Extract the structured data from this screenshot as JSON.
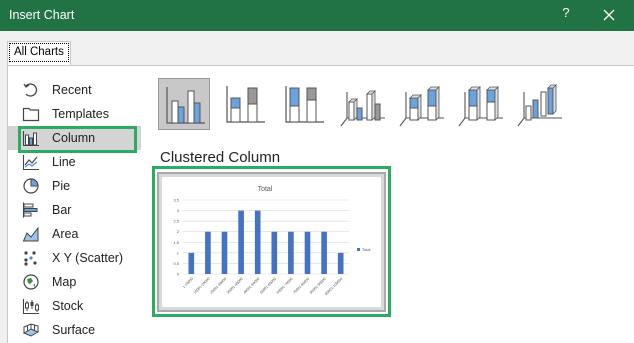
{
  "window": {
    "title": "Insert Chart",
    "help_label": "?"
  },
  "tabs": [
    {
      "label": "All Charts"
    }
  ],
  "sidebar": {
    "items": [
      {
        "label": "Recent",
        "icon": "recent-icon"
      },
      {
        "label": "Templates",
        "icon": "templates-icon"
      },
      {
        "label": "Column",
        "icon": "column-chart-icon",
        "selected": true
      },
      {
        "label": "Line",
        "icon": "line-chart-icon"
      },
      {
        "label": "Pie",
        "icon": "pie-chart-icon"
      },
      {
        "label": "Bar",
        "icon": "bar-chart-icon"
      },
      {
        "label": "Area",
        "icon": "area-chart-icon"
      },
      {
        "label": "X Y (Scatter)",
        "icon": "scatter-chart-icon"
      },
      {
        "label": "Map",
        "icon": "map-chart-icon"
      },
      {
        "label": "Stock",
        "icon": "stock-chart-icon"
      },
      {
        "label": "Surface",
        "icon": "surface-chart-icon"
      }
    ]
  },
  "chart_types": {
    "selected_title": "Clustered Column",
    "options": [
      "clustered-column",
      "stacked-column",
      "100-stacked-column",
      "3d-clustered-column",
      "3d-stacked-column",
      "3d-100-stacked-column",
      "3d-column"
    ]
  },
  "colors": {
    "accent": "#217346",
    "highlight": "#2eab63",
    "bar": "#4472c4"
  },
  "chart_data": {
    "type": "bar",
    "title": "Total",
    "categories": [
      "1-10000",
      "10001-20000",
      "20001-30000",
      "30001-40000",
      "40001-50000",
      "50001-60000",
      "60001-70000",
      "70001-80000",
      "80001-90000",
      "90001-100000"
    ],
    "series": [
      {
        "name": "Total",
        "values": [
          1,
          2,
          2,
          3,
          3,
          2,
          2,
          2,
          2,
          1
        ]
      }
    ],
    "yticks": [
      "0",
      "0.5",
      "1",
      "1.5",
      "2",
      "2.5",
      "3",
      "3.5"
    ],
    "ylim": [
      0,
      3.5
    ],
    "grid": true,
    "legend": "right"
  }
}
